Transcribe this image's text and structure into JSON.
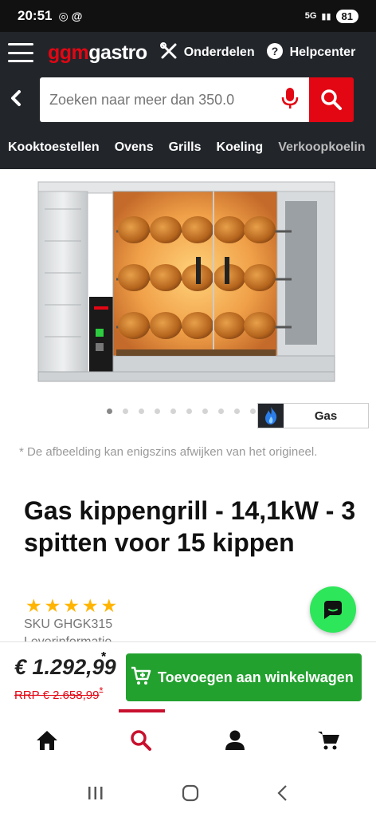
{
  "status_bar": {
    "time": "20:51",
    "signal": "5G",
    "battery": "81"
  },
  "header": {
    "logo_part1": "ggm",
    "logo_part2": "gastro",
    "nav_parts_label": "Onderdelen",
    "nav_help_label": "Helpcenter"
  },
  "search": {
    "placeholder": "Zoeken naar meer dan 350.0"
  },
  "categories": [
    "Kooktoestellen",
    "Ovens",
    "Grills",
    "Koeling",
    "Verkoopkoelin"
  ],
  "gallery": {
    "dot_count": 10,
    "active_dot": 0,
    "badge_label": "Gas"
  },
  "disclaimer": "* De afbeelding kan enigszins afwijken van het origineel.",
  "product": {
    "title": "Gas kippengrill - 14,1kW - 3 spitten voor 15 kippen",
    "rating": 5,
    "sku": "SKU GHGK315",
    "delivery": "Leverinformatie"
  },
  "cart": {
    "price": "€ 1.292,99",
    "price_note": "*",
    "rrp": "RRP € 2.658,99",
    "rrp_note": "*",
    "add_label": "Toevoegen aan winkelwagen"
  },
  "colors": {
    "brand_red": "#e30613",
    "cart_green": "#23a12f",
    "chat_green": "#2ee65a",
    "header_dark": "#22262b"
  },
  "bottom_nav": [
    "home-icon",
    "search-icon",
    "account-icon",
    "cart-icon"
  ]
}
